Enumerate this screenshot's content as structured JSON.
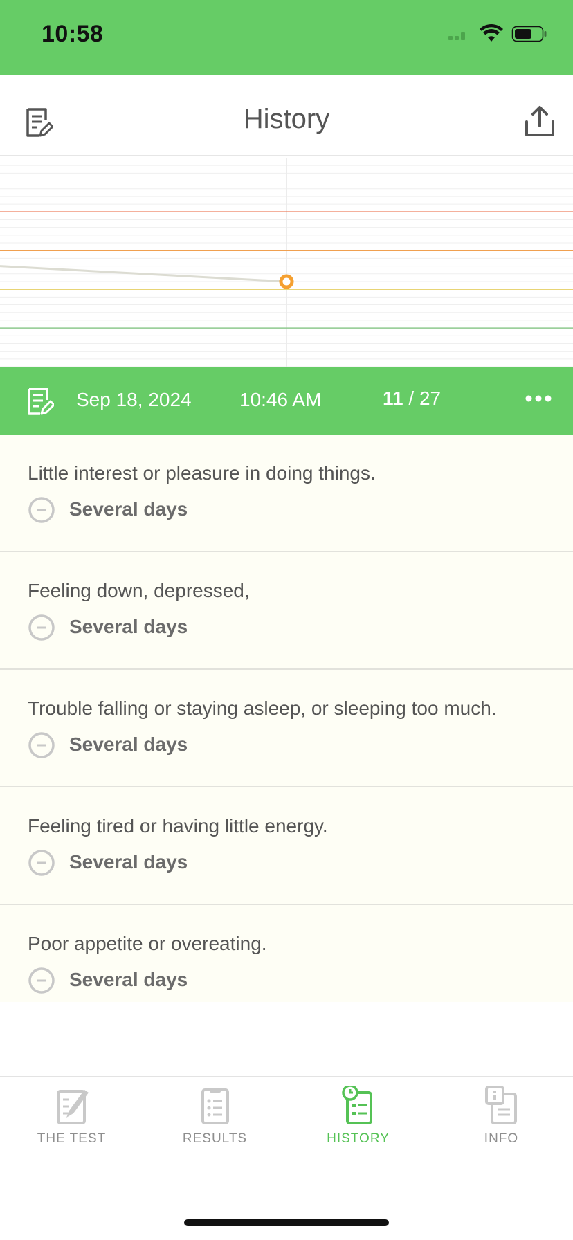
{
  "status_bar": {
    "time": "10:58",
    "icons": [
      "signal-icon",
      "wifi-icon",
      "battery-icon"
    ]
  },
  "header": {
    "title": "History",
    "left_icon": "edit-note-icon",
    "right_icon": "share-icon"
  },
  "colors": {
    "brand_green": "#66cc66",
    "active_tab": "#55c255",
    "row_background": "#fefef5",
    "point_orange": "#f5a030"
  },
  "chart_data": {
    "type": "line",
    "ylim": [
      0,
      27
    ],
    "threshold_lines": [
      {
        "value": 20,
        "color": "#e8623a"
      },
      {
        "value": 15,
        "color": "#f0a050"
      },
      {
        "value": 10,
        "color": "#e6cf60"
      },
      {
        "value": 5,
        "color": "#8ec98e"
      }
    ],
    "series": [
      {
        "values": [
          13,
          11
        ],
        "highlight_index": 1
      }
    ]
  },
  "entry": {
    "icon": "edit-note-icon",
    "date": "Sep 18, 2024",
    "time": "10:46 AM",
    "score": "11",
    "score_separator": " / ",
    "score_max": "27",
    "more_icon": "more-icon"
  },
  "questions": [
    {
      "text": "Little interest or pleasure in doing things.",
      "answer": "Several days"
    },
    {
      "text": "Feeling down, depressed,",
      "answer": "Several days"
    },
    {
      "text": "Trouble falling or staying asleep, or sleeping too much.",
      "answer": "Several days"
    },
    {
      "text": "Feeling tired or having little energy.",
      "answer": "Several days"
    },
    {
      "text": "Poor appetite or overeating.",
      "answer": "Several days"
    }
  ],
  "tabs": [
    {
      "label": "THE TEST",
      "icon": "test-icon",
      "active": false
    },
    {
      "label": "RESULTS",
      "icon": "results-icon",
      "active": false
    },
    {
      "label": "HISTORY",
      "icon": "history-icon",
      "active": true
    },
    {
      "label": "INFO",
      "icon": "info-icon",
      "active": false
    }
  ]
}
